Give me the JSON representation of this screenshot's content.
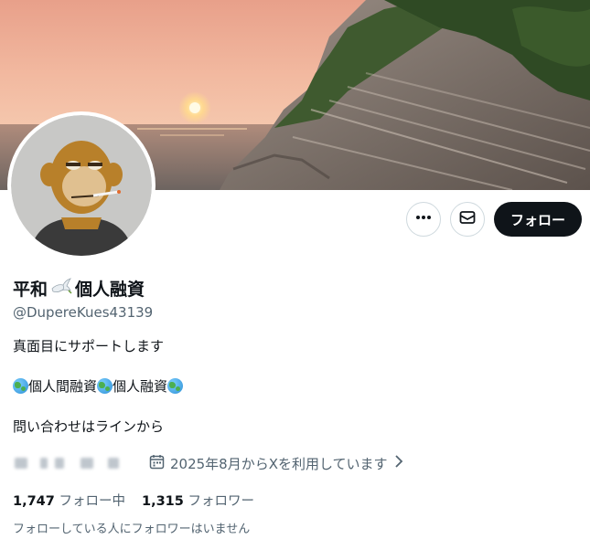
{
  "profile": {
    "name_part1": "平和",
    "name_part2": "個人融資",
    "handle": "@DupereKues43139",
    "bio": {
      "line1": "真面目にサポートします",
      "line2_a": "個人間融資",
      "line2_b": "個人融資",
      "line3": "問い合わせはラインから"
    },
    "joined": "2025年8月からXを利用しています",
    "following_count": "1,747",
    "following_label": "フォロー中",
    "followers_count": "1,315",
    "followers_label": "フォロワー",
    "mutual_note": "フォローしている人にフォロワーはいません"
  },
  "actions": {
    "follow_label": "フォロー"
  },
  "icons": [
    "more-icon",
    "mail-icon",
    "calendar-icon",
    "chevron-right-icon",
    "dove-icon",
    "globe-icon"
  ],
  "colors": {
    "primary_text": "#0f1419",
    "secondary_text": "#536471",
    "follow_button_bg": "#0f1419",
    "border": "#cfd9de"
  }
}
